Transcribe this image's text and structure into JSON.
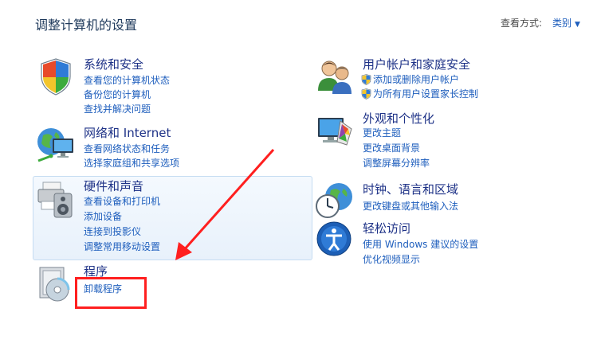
{
  "header": {
    "title": "调整计算机的设置",
    "view_by_label": "查看方式:",
    "view_mode": "类别"
  },
  "left_categories": [
    {
      "title": "系统和安全",
      "icon": "system-security-shield-icon",
      "links": [
        "查看您的计算机状态",
        "备份您的计算机",
        "查找并解决问题"
      ]
    },
    {
      "title": "网络和 Internet",
      "icon": "network-globe-icon",
      "links": [
        "查看网络状态和任务",
        "选择家庭组和共享选项"
      ]
    },
    {
      "title": "硬件和声音",
      "icon": "printer-speaker-icon",
      "links": [
        "查看设备和打印机",
        "添加设备",
        "连接到投影仪",
        "调整常用移动设置"
      ]
    },
    {
      "title": "程序",
      "icon": "programs-disc-icon",
      "links": [
        "卸载程序"
      ]
    }
  ],
  "right_categories": [
    {
      "title": "用户帐户和家庭安全",
      "icon": "users-icon",
      "links": [
        "添加或删除用户帐户",
        "为所有用户设置家长控制"
      ]
    },
    {
      "title": "外观和个性化",
      "icon": "appearance-monitor-icon",
      "links": [
        "更改主题",
        "更改桌面背景",
        "调整屏幕分辨率"
      ]
    },
    {
      "title": "时钟、语言和区域",
      "icon": "clock-globe-icon",
      "links": [
        "更改键盘或其他输入法"
      ]
    },
    {
      "title": "轻松访问",
      "icon": "ease-of-access-icon",
      "links": [
        "使用 Windows 建议的设置",
        "优化视频显示"
      ]
    }
  ],
  "colors": {
    "title": "#1e3287",
    "link": "#1e5ebd",
    "annotation": "#ff1f1f"
  }
}
